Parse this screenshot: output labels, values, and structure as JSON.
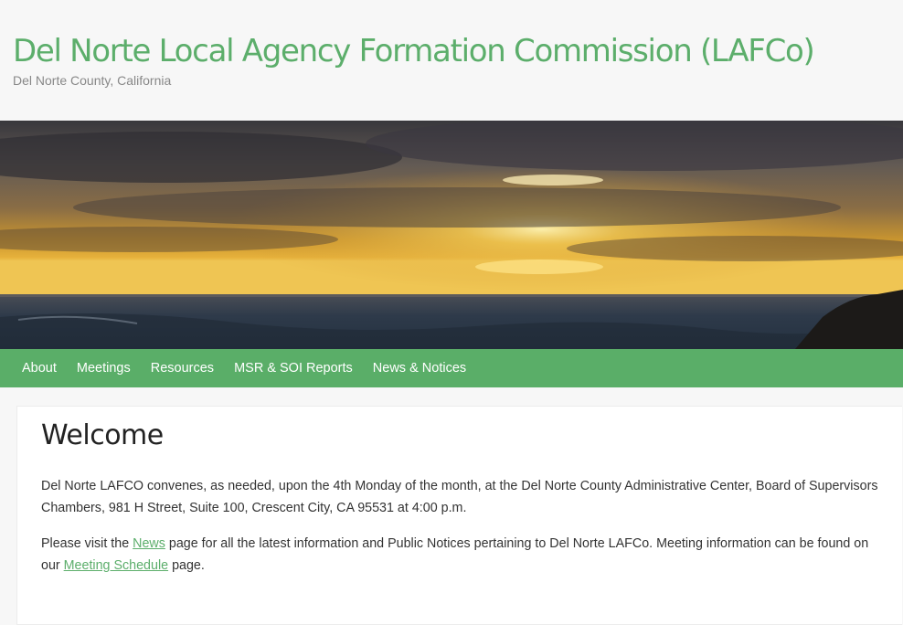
{
  "header": {
    "site_title": "Del Norte Local Agency Formation Commission (LAFCo)",
    "tagline": "Del Norte County, California"
  },
  "hero": {
    "sky_colors": [
      "#3b3a40",
      "#6c6157",
      "#b38a46",
      "#e8b43a",
      "#f6d460"
    ],
    "ocean_color": "#2f3c4c"
  },
  "nav": {
    "items": [
      {
        "label": "About"
      },
      {
        "label": "Meetings"
      },
      {
        "label": "Resources"
      },
      {
        "label": "MSR & SOI Reports"
      },
      {
        "label": "News & Notices"
      }
    ]
  },
  "main": {
    "heading": "Welcome",
    "para1": "Del Norte LAFCO convenes, as needed, upon the 4th Monday of the month, at the Del Norte County Administrative Center, Board of Supervisors Chambers, 981 H Street, Suite 100, Crescent City, CA 95531 at 4:00 p.m.",
    "para2": {
      "before_link1": "Please visit the ",
      "link1": "News",
      "between": " page for all the latest information and Public Notices pertaining to Del Norte LAFCo. Meeting information can be found on our ",
      "link2": "Meeting Schedule",
      "after": " page."
    }
  },
  "colors": {
    "accent": "#5cae6b",
    "nav_bg": "#5aae68",
    "background": "#f7f7f7"
  }
}
